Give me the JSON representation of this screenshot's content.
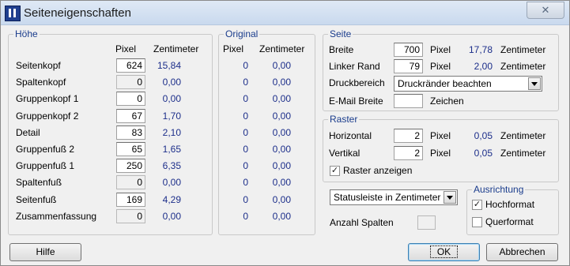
{
  "window": {
    "title": "Seiteneigenschaften",
    "close_glyph": "✕",
    "icon": "app-logo-icon"
  },
  "hoehe": {
    "title": "Höhe",
    "col_pixel": "Pixel",
    "col_cm": "Zentimeter",
    "rows": [
      {
        "label": "Seitenkopf",
        "pixel": "624",
        "cm": "15,84",
        "enabled": true
      },
      {
        "label": "Spaltenkopf",
        "pixel": "0",
        "cm": "0,00",
        "enabled": false
      },
      {
        "label": "Gruppenkopf 1",
        "pixel": "0",
        "cm": "0,00",
        "enabled": true
      },
      {
        "label": "Gruppenkopf 2",
        "pixel": "67",
        "cm": "1,70",
        "enabled": true
      },
      {
        "label": "Detail",
        "pixel": "83",
        "cm": "2,10",
        "enabled": true
      },
      {
        "label": "Gruppenfuß 2",
        "pixel": "65",
        "cm": "1,65",
        "enabled": true
      },
      {
        "label": "Gruppenfuß 1",
        "pixel": "250",
        "cm": "6,35",
        "enabled": true
      },
      {
        "label": "Spaltenfuß",
        "pixel": "0",
        "cm": "0,00",
        "enabled": false
      },
      {
        "label": "Seitenfuß",
        "pixel": "169",
        "cm": "4,29",
        "enabled": true
      },
      {
        "label": "Zusammenfassung",
        "pixel": "0",
        "cm": "0,00",
        "enabled": false
      }
    ]
  },
  "original": {
    "title": "Original",
    "col_pixel": "Pixel",
    "col_cm": "Zentimeter",
    "rows": [
      {
        "pixel": "0",
        "cm": "0,00"
      },
      {
        "pixel": "0",
        "cm": "0,00"
      },
      {
        "pixel": "0",
        "cm": "0,00"
      },
      {
        "pixel": "0",
        "cm": "0,00"
      },
      {
        "pixel": "0",
        "cm": "0,00"
      },
      {
        "pixel": "0",
        "cm": "0,00"
      },
      {
        "pixel": "0",
        "cm": "0,00"
      },
      {
        "pixel": "0",
        "cm": "0,00"
      },
      {
        "pixel": "0",
        "cm": "0,00"
      },
      {
        "pixel": "0",
        "cm": "0,00"
      }
    ]
  },
  "seite": {
    "title": "Seite",
    "breite": {
      "label": "Breite",
      "value": "700",
      "unit": "Pixel",
      "cm": "17,78",
      "cm_unit": "Zentimeter"
    },
    "linker_rand": {
      "label": "Linker Rand",
      "value": "79",
      "unit": "Pixel",
      "cm": "2,00",
      "cm_unit": "Zentimeter"
    },
    "druckbereich": {
      "label": "Druckbereich",
      "selected": "Druckränder beachten"
    },
    "email_breite": {
      "label": "E-Mail Breite",
      "value": "",
      "unit": "Zeichen"
    }
  },
  "raster": {
    "title": "Raster",
    "horizontal": {
      "label": "Horizontal",
      "value": "2",
      "unit": "Pixel",
      "cm": "0,05",
      "cm_unit": "Zentimeter"
    },
    "vertikal": {
      "label": "Vertikal",
      "value": "2",
      "unit": "Pixel",
      "cm": "0,05",
      "cm_unit": "Zentimeter"
    },
    "anzeigen": {
      "label": "Raster anzeigen",
      "checked": true,
      "glyph": "✓"
    }
  },
  "status_select": {
    "selected": "Statusleiste in Zentimeter"
  },
  "anzahl_spalten": {
    "label": "Anzahl Spalten",
    "value": ""
  },
  "ausrichtung": {
    "title": "Ausrichtung",
    "hochformat": {
      "label": "Hochformat",
      "checked": true,
      "glyph": "✓"
    },
    "querformat": {
      "label": "Querformat",
      "checked": false,
      "glyph": ""
    }
  },
  "buttons": {
    "hilfe": "Hilfe",
    "ok": "OK",
    "abbrechen": "Abbrechen"
  }
}
